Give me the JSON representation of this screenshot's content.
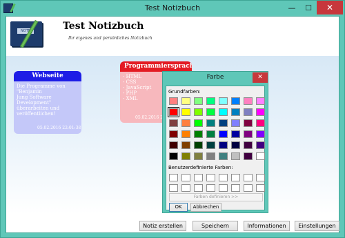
{
  "window": {
    "title": "Test Notizbuch",
    "minimize": "—",
    "maximize": "☐",
    "close": "✕"
  },
  "header": {
    "title": "Test Notizbuch",
    "subtitle": "Ihr eigenes und persönliches Notizbuch",
    "logo_label": "NOTE BOOK"
  },
  "notes": [
    {
      "title": "Webseite",
      "lines": [
        "Die Programme von \"Benjamin",
        "Jung Software Development\"",
        "überarbeiten und veröffentlichen!"
      ],
      "date": "05.02.2016 22:01:38",
      "header_color": "#1d1de6",
      "body_color": "#c4c8f9"
    },
    {
      "title": "Programmiersprachen",
      "lines": [
        "- HTML",
        "- CSS",
        "- JavaScript",
        "- PHP",
        "- XML"
      ],
      "date": "05.02.2016 22:",
      "header_color": "#e31b23",
      "body_color": "#f7b8bd"
    }
  ],
  "buttons": {
    "create": "Notiz erstellen",
    "save": "Speichern",
    "info": "Informationen",
    "settings": "Einstellungen"
  },
  "color_dialog": {
    "title": "Farbe",
    "close": "✕",
    "basic_label": "Grundfarben:",
    "custom_label": "Benutzerdefinierte Farben:",
    "define_button": "Farben definieren >>",
    "ok": "OK",
    "cancel": "Abbrechen",
    "selected_index": 8,
    "basic_colors": [
      "#ff8080",
      "#ffff80",
      "#80ff80",
      "#00ff80",
      "#80ffff",
      "#0080ff",
      "#ff80c0",
      "#ff80ff",
      "#ff0000",
      "#ffff00",
      "#80ff00",
      "#00ff40",
      "#00ffff",
      "#0080c0",
      "#8080c0",
      "#ff00ff",
      "#804040",
      "#ff8040",
      "#00ff00",
      "#008080",
      "#004080",
      "#8080ff",
      "#800040",
      "#ff0080",
      "#800000",
      "#ff8000",
      "#008000",
      "#008040",
      "#0000ff",
      "#0000a0",
      "#800080",
      "#8000ff",
      "#400000",
      "#804000",
      "#004000",
      "#004040",
      "#000080",
      "#000040",
      "#400040",
      "#400080",
      "#000000",
      "#808000",
      "#808040",
      "#808080",
      "#408080",
      "#c0c0c0",
      "#400040",
      "#ffffff"
    ],
    "custom_colors": [
      "#ffffff",
      "#ffffff",
      "#ffffff",
      "#ffffff",
      "#ffffff",
      "#ffffff",
      "#ffffff",
      "#ffffff",
      "#ffffff",
      "#ffffff",
      "#ffffff",
      "#ffffff",
      "#ffffff",
      "#ffffff",
      "#ffffff",
      "#ffffff"
    ]
  }
}
